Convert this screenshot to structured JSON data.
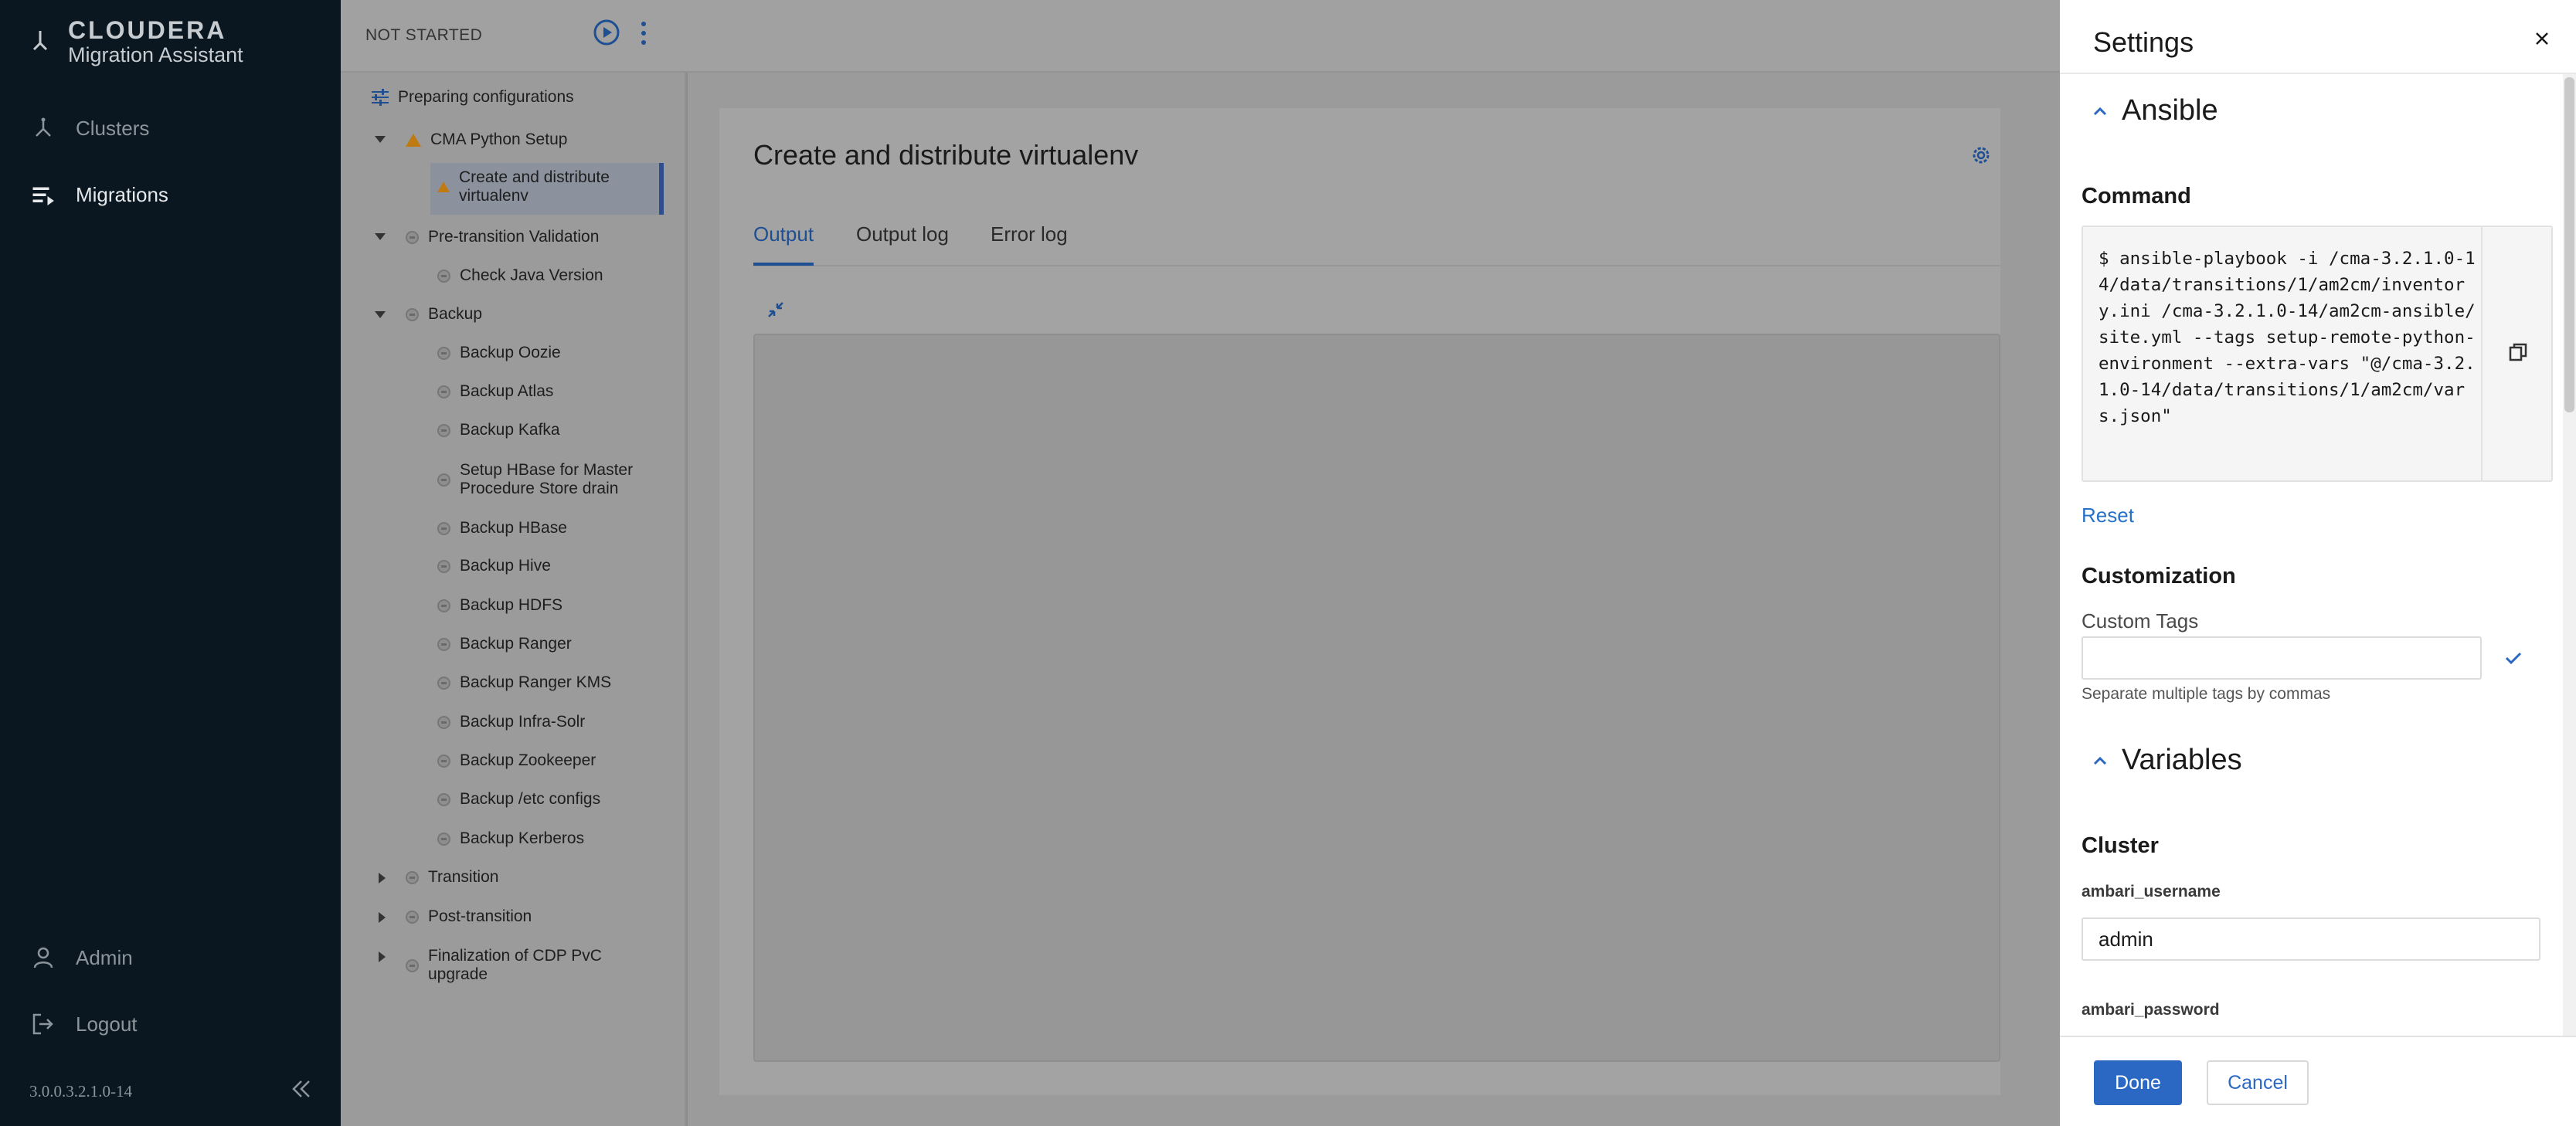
{
  "brand": {
    "name": "CLOUDERA",
    "product": "Migration Assistant"
  },
  "nav": {
    "items": [
      {
        "label": "Clusters",
        "icon": "clusters-icon"
      },
      {
        "label": "Migrations",
        "icon": "migrations-icon",
        "active": true
      }
    ],
    "bottom": [
      {
        "label": "Admin",
        "icon": "person-icon"
      },
      {
        "label": "Logout",
        "icon": "logout-icon"
      }
    ],
    "version": "3.0.0.3.2.1.0-14"
  },
  "topbar": {
    "status": "NOT STARTED"
  },
  "tree": {
    "root": "Preparing configurations",
    "items": [
      {
        "label": "CMA Python Setup",
        "status": "warning",
        "expanded": true
      },
      {
        "label": "Create and distribute virtualenv",
        "status": "warning",
        "selected": true
      },
      {
        "label": "Pre-transition Validation",
        "status": "pending",
        "expanded": true
      },
      {
        "label": "Check Java Version",
        "status": "pending"
      },
      {
        "label": "Backup",
        "status": "pending",
        "expanded": true
      },
      {
        "label": "Backup Oozie",
        "status": "pending"
      },
      {
        "label": "Backup Atlas",
        "status": "pending"
      },
      {
        "label": "Backup Kafka",
        "status": "pending"
      },
      {
        "label": "Setup HBase for Master Procedure Store drain",
        "status": "pending"
      },
      {
        "label": "Backup HBase",
        "status": "pending"
      },
      {
        "label": "Backup Hive",
        "status": "pending"
      },
      {
        "label": "Backup HDFS",
        "status": "pending"
      },
      {
        "label": "Backup Ranger",
        "status": "pending"
      },
      {
        "label": "Backup Ranger KMS",
        "status": "pending"
      },
      {
        "label": "Backup Infra-Solr",
        "status": "pending"
      },
      {
        "label": "Backup Zookeeper",
        "status": "pending"
      },
      {
        "label": "Backup /etc configs",
        "status": "pending"
      },
      {
        "label": "Backup Kerberos",
        "status": "pending"
      },
      {
        "label": "Transition",
        "status": "pending",
        "expanded": false
      },
      {
        "label": "Post-transition",
        "status": "pending",
        "expanded": false
      },
      {
        "label": "Finalization of CDP PvC upgrade",
        "status": "pending",
        "expanded": false
      }
    ]
  },
  "content": {
    "title": "Create and distribute virtualenv",
    "tabs": [
      "Output",
      "Output log",
      "Error log"
    ],
    "active_tab": "Output"
  },
  "settings": {
    "title": "Settings",
    "ansible_section": "Ansible",
    "command_heading": "Command",
    "command": "$ ansible-playbook -i /cma-3.2.1.0-14/data/transitions/1/am2cm/inventory.ini /cma-3.2.1.0-14/am2cm-ansible/site.yml --tags setup-remote-python-environment --extra-vars \"@/cma-3.2.1.0-14/data/transitions/1/am2cm/vars.json\"",
    "reset_label": "Reset",
    "customization_heading": "Customization",
    "custom_tags_label": "Custom Tags",
    "custom_tags_value": "",
    "custom_tags_help": "Separate multiple tags by commas",
    "variables_section": "Variables",
    "cluster_heading": "Cluster",
    "ambari_username_label": "ambari_username",
    "ambari_username_value": "admin",
    "ambari_password_label": "ambari_password",
    "done_label": "Done",
    "cancel_label": "Cancel"
  },
  "colors": {
    "accent": "#2b68c4",
    "warning": "#c07a12",
    "nav_bg": "#0a1720"
  }
}
